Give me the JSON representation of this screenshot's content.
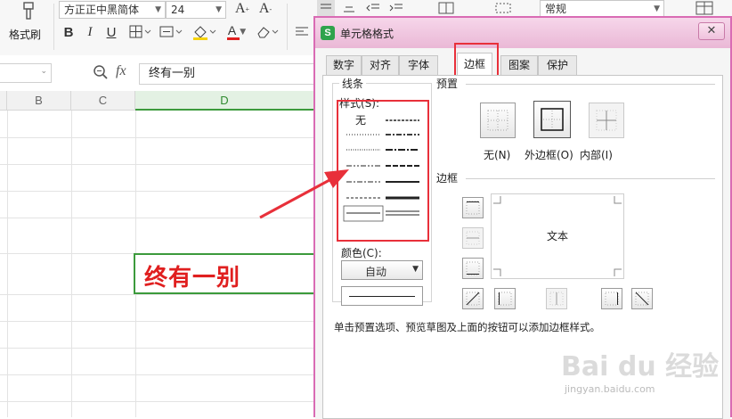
{
  "toolbar": {
    "format_painter_label": "格式刷",
    "font_name": "方正正中黑简体",
    "font_size": "24",
    "number_format": "常规",
    "bold": "B",
    "italic": "I",
    "underline": "U",
    "grow_font": "A",
    "shrink_font": "A",
    "font_color": "A"
  },
  "formula_bar": {
    "fx": "fx",
    "content": "终有一别"
  },
  "sheet": {
    "columns": [
      "B",
      "C",
      "D"
    ],
    "cell_text": "终有一别",
    "cell_text_color": "#e01f1f",
    "active_col_color": "#3c9a3c"
  },
  "dialog": {
    "title": "单元格格式",
    "tabs": [
      "数字",
      "对齐",
      "字体",
      "边框",
      "图案",
      "保护"
    ],
    "active_tab": "边框",
    "line_group": {
      "title": "线条",
      "style_label": "样式(S):",
      "none_label": "无",
      "color_label": "颜色(C):",
      "color_value": "自动"
    },
    "presets": {
      "title": "预置",
      "none": "无(N)",
      "outline": "外边框(O)",
      "inside": "内部(I)"
    },
    "border": {
      "title": "边框",
      "preview_text": "文本"
    },
    "hint": "单击预置选项、预览草图及上面的按钮可以添加边框样式。",
    "accent": "#e8303a"
  },
  "watermark": {
    "brand": "Bai du 经验",
    "url": "jingyan.baidu.com"
  }
}
